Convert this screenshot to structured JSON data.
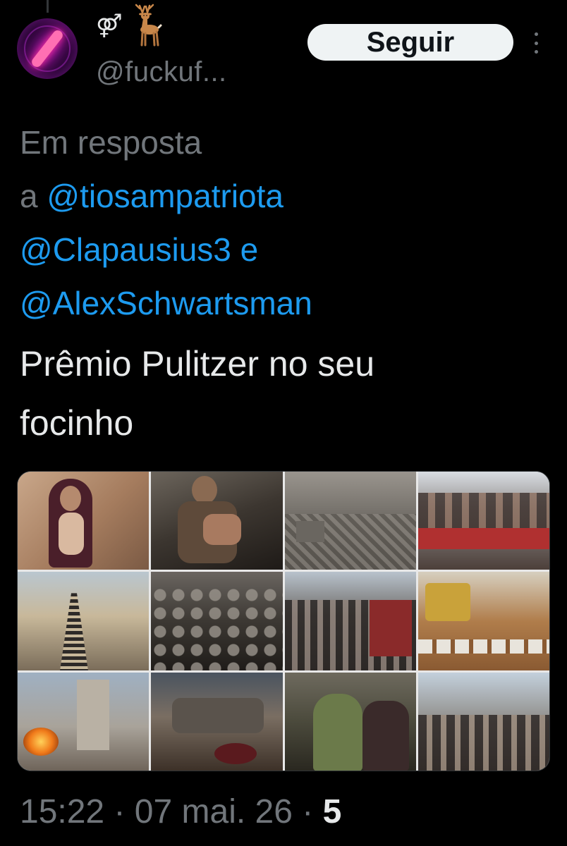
{
  "tweet": {
    "author": {
      "display_name_icons": [
        "male-female-symbol",
        "deer-emoji"
      ],
      "display_name_symbol": "⚤",
      "handle": "@fuckuf...",
      "avatar_icon": "neon-capsule-avatar"
    },
    "follow_button_label": "Seguir",
    "more_options_icon": "vertical-dots-icon",
    "reply_context": {
      "prefix_line1": "Em resposta",
      "prefix_a": "a",
      "mentions": [
        "@tiosampatriota",
        "@Clapausius3",
        "@AlexSchwartsman"
      ],
      "conjunction": "e"
    },
    "text_line1": "Prêmio Pulitzer no seu",
    "text_line2": "focinho",
    "media": {
      "type": "photo-collage",
      "tiles": 12
    },
    "meta": {
      "time": "15:22",
      "separator": "·",
      "date": "07 mai. 26",
      "views": "5"
    }
  },
  "colors": {
    "background": "#000000",
    "primary_text": "#e7e9ea",
    "secondary_text": "#71767b",
    "link": "#1d9bf0",
    "follow_button_bg": "#eff3f4",
    "follow_button_text": "#0f1419"
  }
}
